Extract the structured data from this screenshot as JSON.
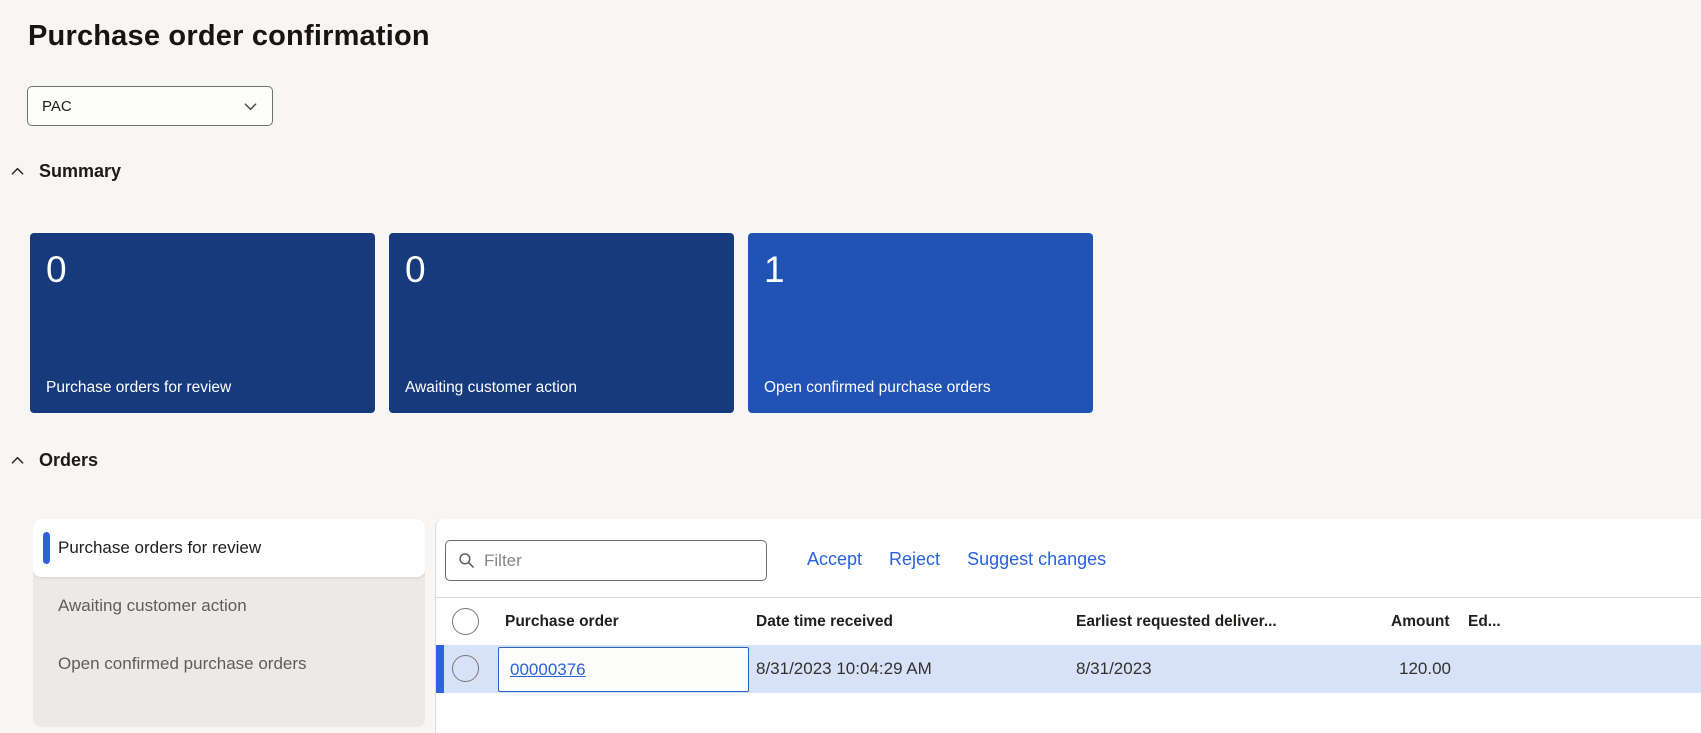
{
  "page_title": "Purchase order confirmation",
  "record_selector": {
    "value": "PAC"
  },
  "summary": {
    "heading": "Summary",
    "tiles": [
      {
        "value": "0",
        "label": "Purchase orders for review",
        "bg": "#173a7c"
      },
      {
        "value": "0",
        "label": "Awaiting customer action",
        "bg": "#173a7c"
      },
      {
        "value": "1",
        "label": "Open confirmed purchase orders",
        "bg": "#2053b3"
      }
    ]
  },
  "orders": {
    "heading": "Orders",
    "nav": [
      {
        "label": "Purchase orders for review",
        "selected": true
      },
      {
        "label": "Awaiting customer action",
        "selected": false
      },
      {
        "label": "Open confirmed purchase orders",
        "selected": false
      }
    ],
    "filter_placeholder": "Filter",
    "actions": {
      "accept": "Accept",
      "reject": "Reject",
      "suggest": "Suggest changes"
    },
    "table": {
      "columns": {
        "purchase_order": "Purchase order",
        "date_time_received": "Date time received",
        "earliest_requested": "Earliest requested deliver...",
        "amount": "Amount",
        "edit": "Ed..."
      },
      "rows": [
        {
          "purchase_order": "00000376",
          "date_time_received": "8/31/2023 10:04:29 AM",
          "earliest_requested": "8/31/2023",
          "amount": "120.00"
        }
      ]
    }
  },
  "colors": {
    "accent_link": "#2a61dd",
    "selection_bar": "#2e63df",
    "row_highlight": "#d7e2f9",
    "tile_dark": "#173a7c",
    "tile_bright": "#2053b3",
    "page_background": "#f7f6f4"
  }
}
